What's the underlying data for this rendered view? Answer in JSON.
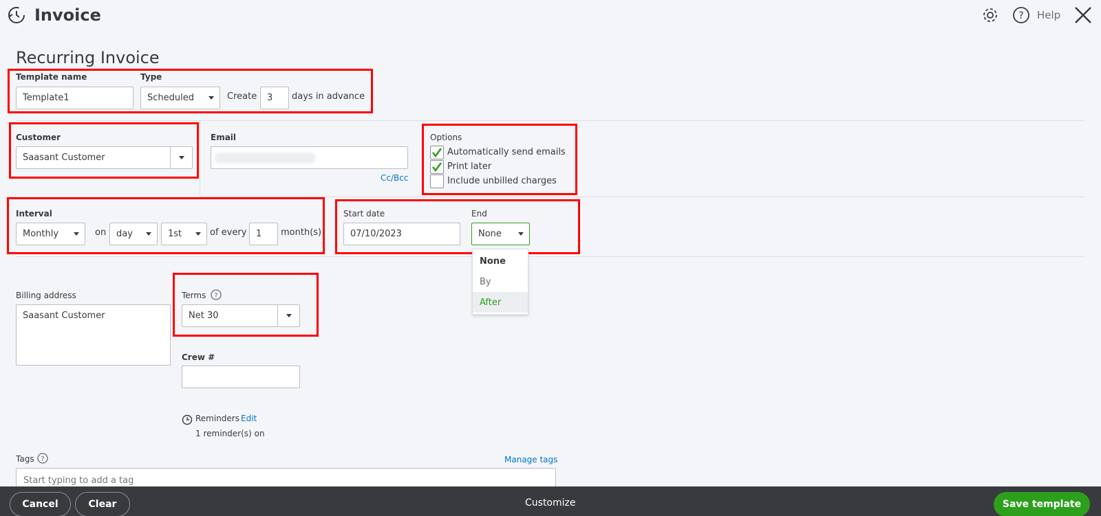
{
  "header": {
    "title": "Invoice",
    "help_label": "Help"
  },
  "page": {
    "title": "Recurring Invoice"
  },
  "template": {
    "name_label": "Template name",
    "name_value": "Template1",
    "type_label": "Type",
    "type_value": "Scheduled",
    "create_label": "Create",
    "days_value": "3",
    "days_suffix": "days in advance"
  },
  "customer": {
    "label": "Customer",
    "value": "Saasant Customer"
  },
  "email": {
    "label": "Email",
    "value": "",
    "cc_bcc": "Cc/Bcc"
  },
  "options": {
    "label": "Options",
    "items": [
      {
        "label": "Automatically send emails",
        "checked": true
      },
      {
        "label": "Print later",
        "checked": true
      },
      {
        "label": "Include unbilled charges",
        "checked": false
      }
    ]
  },
  "interval": {
    "label": "Interval",
    "value": "Monthly",
    "on_label": "on",
    "day_value": "day",
    "ordinal_value": "1st",
    "of_every_label": "of every",
    "every_value": "1",
    "unit_label": "month(s)"
  },
  "schedule": {
    "start_label": "Start date",
    "start_value": "07/10/2023",
    "end_label": "End",
    "end_value": "None",
    "end_options": [
      "None",
      "By",
      "After"
    ]
  },
  "billing": {
    "label": "Billing address",
    "value": "Saasant Customer"
  },
  "terms": {
    "label": "Terms",
    "value": "Net 30"
  },
  "crew": {
    "label": "Crew #",
    "value": ""
  },
  "reminders": {
    "label": "Reminders",
    "edit_label": "Edit",
    "status": "1 reminder(s) on"
  },
  "tags": {
    "label": "Tags",
    "manage_label": "Manage tags",
    "placeholder": "Start typing to add a tag"
  },
  "footer": {
    "cancel_label": "Cancel",
    "clear_label": "Clear",
    "customize_label": "Customize",
    "save_label": "Save template"
  },
  "colors": {
    "accent_green": "#2ca01c",
    "link_blue": "#0077c5",
    "highlight_red": "#ff0000",
    "footer_bg": "#393a3d"
  }
}
